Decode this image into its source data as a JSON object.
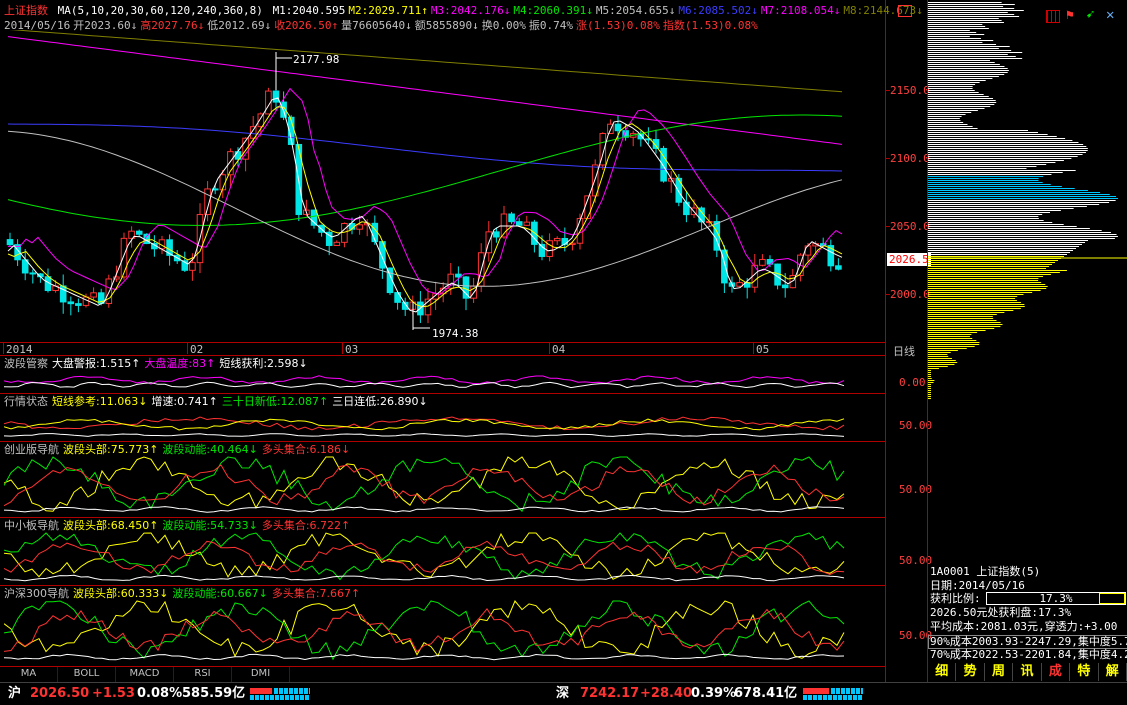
{
  "header": {
    "name": "上证指数",
    "ma_params": "MA(5,10,20,30,60,120,240,360,8)",
    "ma_values": [
      {
        "label": "M1:2040.595",
        "color": "#ffffff"
      },
      {
        "label": "M2:2029.711",
        "color": "#ffff00",
        "arrow": "↑"
      },
      {
        "label": "M3:2042.176",
        "color": "#ff00ff",
        "arrow": "↓"
      },
      {
        "label": "M4:2060.391",
        "color": "#00e600",
        "arrow": "↓"
      },
      {
        "label": "M5:2054.655",
        "color": "#c0c0c0",
        "arrow": "↓"
      },
      {
        "label": "M6:2085.502",
        "color": "#3c3cff",
        "arrow": "↓"
      },
      {
        "label": "M7:2108.054",
        "color": "#ff00ff",
        "arrow": "↓"
      },
      {
        "label": "M8:2144.673",
        "color": "#808000",
        "arrow": "↓"
      }
    ],
    "line2": [
      {
        "t": "2014/05/16",
        "c": "#c0c0c0"
      },
      {
        "t": "开2023.60↓",
        "c": "#c0c0c0"
      },
      {
        "t": "高2027.76↓",
        "c": "#ff3232"
      },
      {
        "t": "低2012.69↓",
        "c": "#c0c0c0"
      },
      {
        "t": "收2026.50↑",
        "c": "#ff3232"
      },
      {
        "t": "量76605640↓",
        "c": "#c0c0c0"
      },
      {
        "t": "额5855890↓",
        "c": "#c0c0c0"
      },
      {
        "t": "换0.00%",
        "c": "#c0c0c0"
      },
      {
        "t": "振0.74%",
        "c": "#c0c0c0"
      },
      {
        "t": "涨(1.53)0.08%",
        "c": "#ff3232"
      },
      {
        "t": "指数(1.53)0.08%",
        "c": "#ff3232"
      }
    ],
    "high_mark": "2177.98",
    "low_mark": "1974.38",
    "current_price": "2026.5"
  },
  "price_axis": [
    "2150.0",
    "2100.0",
    "2050.0",
    "2000.0"
  ],
  "date_axis": [
    "2014",
    "02",
    "03",
    "04",
    "05"
  ],
  "period": "日线",
  "indicators": [
    {
      "id": "boduan",
      "title": "波段管察",
      "items": [
        {
          "t": "大盘警报:1.515↑",
          "c": "#ffffff"
        },
        {
          "t": "大盘温度:83↑",
          "c": "#ff00ff"
        },
        {
          "t": "短线获利:2.598↓",
          "c": "#ffffff"
        }
      ],
      "axis": "0.00"
    },
    {
      "id": "hangqing",
      "title": "行情状态",
      "items": [
        {
          "t": "短线参考:11.063↓",
          "c": "#ffff00"
        },
        {
          "t": "增速:0.741↑",
          "c": "#ffffff"
        },
        {
          "t": "三十日新低:12.087↑",
          "c": "#00e600"
        },
        {
          "t": "三日连低:26.890↓",
          "c": "#ffffff"
        }
      ],
      "axis": "50.00"
    },
    {
      "id": "chuangye",
      "title": "创业版导航",
      "items": [
        {
          "t": "波段头部:75.773↑",
          "c": "#ffff00"
        },
        {
          "t": "波段动能:40.464↓",
          "c": "#00e600"
        },
        {
          "t": "多头集合:6.186↓",
          "c": "#ff3232"
        }
      ],
      "axis": "50.00"
    },
    {
      "id": "zhongxiao",
      "title": "中小板导航",
      "items": [
        {
          "t": "波段头部:68.450↑",
          "c": "#ffff00"
        },
        {
          "t": "波段动能:54.733↓",
          "c": "#00e600"
        },
        {
          "t": "多头集合:6.722↑",
          "c": "#ff3232"
        }
      ],
      "axis": "50.00"
    },
    {
      "id": "hushen",
      "title": "沪深300导航",
      "items": [
        {
          "t": "波段头部:60.333↓",
          "c": "#ffff00"
        },
        {
          "t": "波段动能:60.667↓",
          "c": "#00e600"
        },
        {
          "t": "多头集合:7.667↑",
          "c": "#ff3232"
        }
      ],
      "axis": "50.00"
    }
  ],
  "tabs": [
    "MA",
    "BOLL",
    "MACD",
    "RSI",
    "DMI"
  ],
  "right_panel": {
    "code_line": "1A0001 上证指数(5)",
    "date_line": "日期:2014/05/16",
    "profit_label": "获利比例:",
    "profit_value": "17.3%",
    "profit_ratio": 0.173,
    "line_profit": "2026.50元处获利盘:17.3%",
    "line_avg": "平均成本:2081.03元,穿透力:+3.00",
    "line_90": "90%成本2003.93-2247.29,集中度5.7",
    "line_70": "70%成本2022.53-2201.84,集中度4.2",
    "bottom_tabs": [
      "细",
      "势",
      "周",
      "讯",
      "成",
      "特",
      "解"
    ]
  },
  "statusbar": {
    "sh_label": "沪",
    "sh_price": "2026.50",
    "sh_change": "+1.53",
    "sh_pct": "0.08%",
    "sh_amount": "585.59亿",
    "sz_label": "深",
    "sz_price": "7242.17",
    "sz_change": "+28.40",
    "sz_pct": "0.39%",
    "sz_amount": "678.41亿"
  }
}
